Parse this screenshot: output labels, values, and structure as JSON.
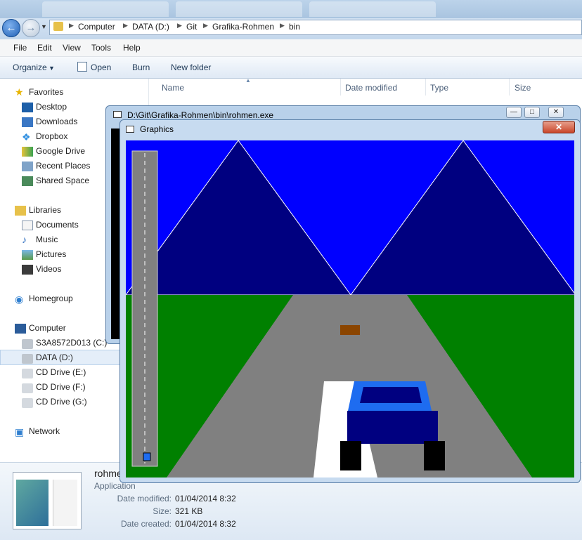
{
  "explorer": {
    "breadcrumb": [
      "Computer",
      "DATA (D:)",
      "Git",
      "Grafika-Rohmen",
      "bin"
    ],
    "menu": [
      "File",
      "Edit",
      "View",
      "Tools",
      "Help"
    ],
    "commands": {
      "organize": "Organize",
      "open": "Open",
      "burn": "Burn",
      "new_folder": "New folder"
    },
    "nav": {
      "favorites": "Favorites",
      "favorite_items": [
        "Desktop",
        "Downloads",
        "Dropbox",
        "Google Drive",
        "Recent Places",
        "Shared Space"
      ],
      "libraries": "Libraries",
      "library_items": [
        "Documents",
        "Music",
        "Pictures",
        "Videos"
      ],
      "homegroup": "Homegroup",
      "computer": "Computer",
      "drives": [
        "S3A8572D013 (C:)",
        "DATA (D:)",
        "CD Drive (E:)",
        "CD Drive (F:)",
        "CD Drive (G:)"
      ],
      "network": "Network"
    },
    "columns": {
      "name": "Name",
      "date_modified": "Date modified",
      "type": "Type",
      "size": "Size"
    },
    "details": {
      "file_name": "rohme",
      "file_type": "Application",
      "date_modified_label": "Date modified:",
      "date_modified": "01/04/2014 8:32",
      "size_label": "Size:",
      "size": "321 KB",
      "date_created_label": "Date created:",
      "date_created": "01/04/2014 8:32"
    }
  },
  "console_window": {
    "title": "D:\\Git\\Grafika-Rohmen\\bin\\rohmen.exe"
  },
  "graphics_window": {
    "title": "Graphics"
  },
  "colors": {
    "sky": "#0000ff",
    "mountain": "#000080",
    "grass": "#008000",
    "road": "#808080",
    "car_body": "#000080",
    "car_top": "#1e6cf0",
    "obstacle": "#8b4500",
    "minimap_road": "#808080",
    "player_marker": "#1e6cf0"
  }
}
